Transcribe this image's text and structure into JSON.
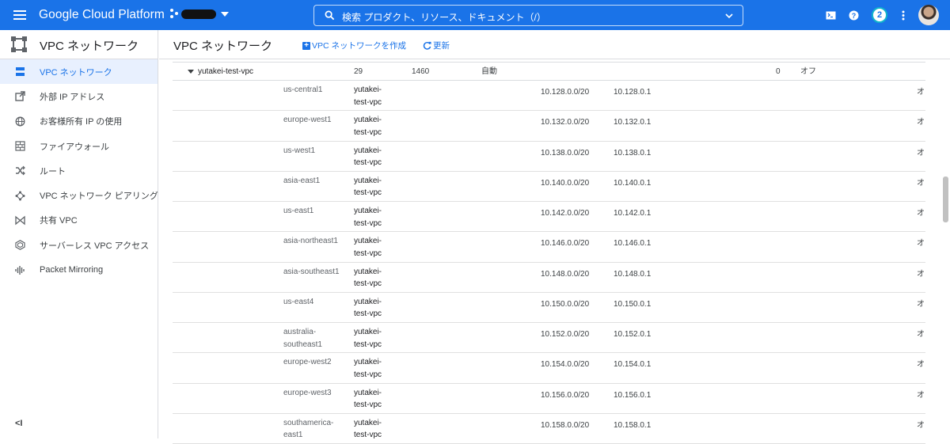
{
  "topbar": {
    "brand": "Google Cloud Platform",
    "search_placeholder": "検索  プロダクト、リソース、ドキュメント（/）",
    "notification_count": "2",
    "accent": "#1a73e8"
  },
  "sidebar": {
    "title": "VPC ネットワーク",
    "items": [
      {
        "label": "VPC ネットワーク",
        "icon": "vpc-network-icon"
      },
      {
        "label": "外部 IP アドレス",
        "icon": "external-ip-icon"
      },
      {
        "label": "お客様所有 IP の使用",
        "icon": "globe-ip-icon"
      },
      {
        "label": "ファイアウォール",
        "icon": "firewall-icon"
      },
      {
        "label": "ルート",
        "icon": "routes-icon"
      },
      {
        "label": "VPC ネットワーク ピアリング",
        "icon": "peering-icon"
      },
      {
        "label": "共有 VPC",
        "icon": "shared-vpc-icon"
      },
      {
        "label": "サーバーレス VPC アクセス",
        "icon": "serverless-icon"
      },
      {
        "label": "Packet Mirroring",
        "icon": "packet-mirroring-icon"
      }
    ],
    "collapse_label": "<I"
  },
  "main": {
    "title": "VPC ネットワーク",
    "create_label": "VPC ネットワークを作成",
    "refresh_label": "更新"
  },
  "vpc": {
    "name": "yutakei-test-vpc",
    "subnet_count": "29",
    "mtu": "1460",
    "mode": "自動",
    "rules": "0",
    "flow": "オフ"
  },
  "subnets": [
    {
      "region": "us-central1",
      "network": "yutakei-test-vpc",
      "range": "10.128.0.0/20",
      "gateway": "10.128.0.1",
      "flag": "オ"
    },
    {
      "region": "europe-west1",
      "network": "yutakei-test-vpc",
      "range": "10.132.0.0/20",
      "gateway": "10.132.0.1",
      "flag": "オ"
    },
    {
      "region": "us-west1",
      "network": "yutakei-test-vpc",
      "range": "10.138.0.0/20",
      "gateway": "10.138.0.1",
      "flag": "オ"
    },
    {
      "region": "asia-east1",
      "network": "yutakei-test-vpc",
      "range": "10.140.0.0/20",
      "gateway": "10.140.0.1",
      "flag": "オ"
    },
    {
      "region": "us-east1",
      "network": "yutakei-test-vpc",
      "range": "10.142.0.0/20",
      "gateway": "10.142.0.1",
      "flag": "オ"
    },
    {
      "region": "asia-northeast1",
      "network": "yutakei-test-vpc",
      "range": "10.146.0.0/20",
      "gateway": "10.146.0.1",
      "flag": "オ"
    },
    {
      "region": "asia-southeast1",
      "network": "yutakei-test-vpc",
      "range": "10.148.0.0/20",
      "gateway": "10.148.0.1",
      "flag": "オ"
    },
    {
      "region": "us-east4",
      "network": "yutakei-test-vpc",
      "range": "10.150.0.0/20",
      "gateway": "10.150.0.1",
      "flag": "オ"
    },
    {
      "region": "australia-southeast1",
      "network": "yutakei-test-vpc",
      "range": "10.152.0.0/20",
      "gateway": "10.152.0.1",
      "flag": "オ"
    },
    {
      "region": "europe-west2",
      "network": "yutakei-test-vpc",
      "range": "10.154.0.0/20",
      "gateway": "10.154.0.1",
      "flag": "オ"
    },
    {
      "region": "europe-west3",
      "network": "yutakei-test-vpc",
      "range": "10.156.0.0/20",
      "gateway": "10.156.0.1",
      "flag": "オ"
    },
    {
      "region": "southamerica-east1",
      "network": "yutakei-test-vpc",
      "range": "10.158.0.0/20",
      "gateway": "10.158.0.1",
      "flag": "オ"
    }
  ]
}
